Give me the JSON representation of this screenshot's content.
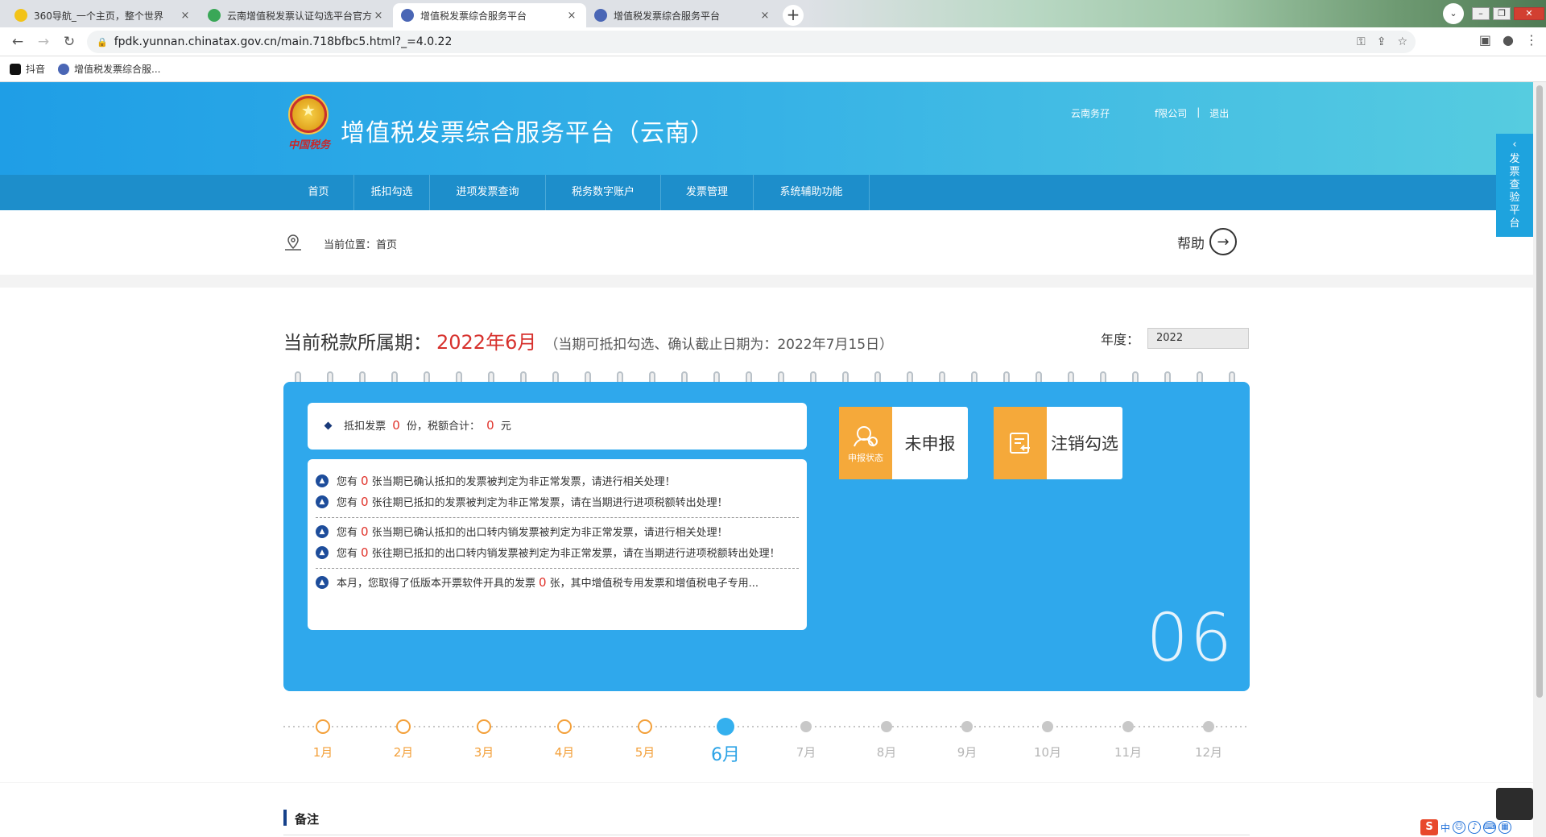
{
  "browser": {
    "tabs": [
      {
        "title": "360导航_一个主页，整个世界",
        "icon_color": "#f2c318",
        "active": false
      },
      {
        "title": "云南增值税发票认证勾选平台官方",
        "icon_color": "#3aa757",
        "active": false
      },
      {
        "title": "增值税发票综合服务平台",
        "icon_color": "#4a66b5",
        "active": true
      },
      {
        "title": "增值税发票综合服务平台",
        "icon_color": "#4a66b5",
        "active": false
      }
    ],
    "close_glyph": "×",
    "new_tab_glyph": "+",
    "url": "fpdk.yunnan.chinatax.gov.cn/main.718bfbc5.html?_=4.0.22",
    "bookmarks": [
      {
        "label": "抖音",
        "icon_color": "#111111"
      },
      {
        "label": "增值税发票综合服...",
        "icon_color": "#4a66b5"
      }
    ]
  },
  "site": {
    "title": "增值税发票综合服务平台（云南）",
    "seal_text": "中国税务",
    "user_company": "云南第??公司",
    "user_left": "云南务孖",
    "user_right": "f限公司",
    "logout": "退出",
    "sep": "|"
  },
  "nav": {
    "items": [
      "首页",
      "抵扣勾选",
      "进项发票查询",
      "税务数字账户",
      "发票管理",
      "系统辅助功能"
    ]
  },
  "breadcrumb": {
    "text": "当前位置：首页",
    "help": "帮助"
  },
  "side_tab": {
    "label_chars": [
      "发",
      "票",
      "查",
      "验",
      "平",
      "台"
    ]
  },
  "period": {
    "label": "当前税款所属期：",
    "month": "2022年6月",
    "note": "（当期可抵扣勾选、确认截止日期为：2022年7月15日）",
    "year_label": "年度：",
    "year_value": "2022"
  },
  "stats": {
    "deduct_prefix": "抵扣发票",
    "deduct_count": "0",
    "deduct_mid": "份，税额合计：",
    "deduct_amount": "0",
    "deduct_suffix": "元"
  },
  "alerts": [
    {
      "pre": "您有",
      "num": "0",
      "post": "张当期已确认抵扣的发票被判定为非正常发票，请进行相关处理！"
    },
    {
      "pre": "您有",
      "num": "0",
      "post": "张往期已抵扣的发票被判定为非正常发票，请在当期进行进项税额转出处理！"
    },
    {
      "pre": "您有",
      "num": "0",
      "post": "张当期已确认抵扣的出口转内销发票被判定为非正常发票，请进行相关处理！"
    },
    {
      "pre": "您有",
      "num": "0",
      "post": "张往期已抵扣的出口转内销发票被判定为非正常发票，请在当期进行进项税额转出处理！"
    },
    {
      "pre": "本月，您取得了低版本开票软件开具的发票",
      "num": "0",
      "post": "张，其中增值税专用发票和增值税电子专用..."
    }
  ],
  "cards": {
    "status_caption": "申报状态",
    "status_value": "未申报",
    "cancel_label": "注销勾选"
  },
  "big_month": "06",
  "timeline": {
    "months": [
      "1月",
      "2月",
      "3月",
      "4月",
      "5月",
      "6月",
      "7月",
      "8月",
      "9月",
      "10月",
      "11月",
      "12月"
    ],
    "current_index": 5,
    "colors": {
      "past": "#f3a03a",
      "current": "#2ba3e6",
      "future": "#b5b5b5"
    }
  },
  "notes": {
    "title": "备注"
  },
  "ime": {
    "logo": "S",
    "mode": "中"
  }
}
